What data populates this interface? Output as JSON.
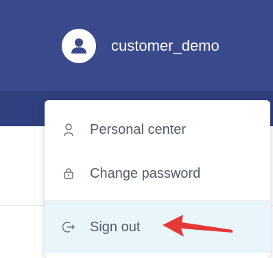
{
  "header": {
    "user": {
      "avatar_icon": "user-avatar-icon",
      "username": "customer_demo"
    }
  },
  "user_menu": {
    "items": [
      {
        "label": "Personal center",
        "icon": "person-icon"
      },
      {
        "label": "Change password",
        "icon": "lock-icon"
      },
      {
        "label": "Sign out",
        "icon": "logout-icon"
      }
    ],
    "highlight_color": "#e8f6fb"
  },
  "annotation": {
    "arrow_icon": "red-arrow-icon",
    "color": "#e53935"
  },
  "colors": {
    "header_bg": "#3a4a8c",
    "subbar_bg": "#2f3f80",
    "menu_text": "#555a66"
  }
}
